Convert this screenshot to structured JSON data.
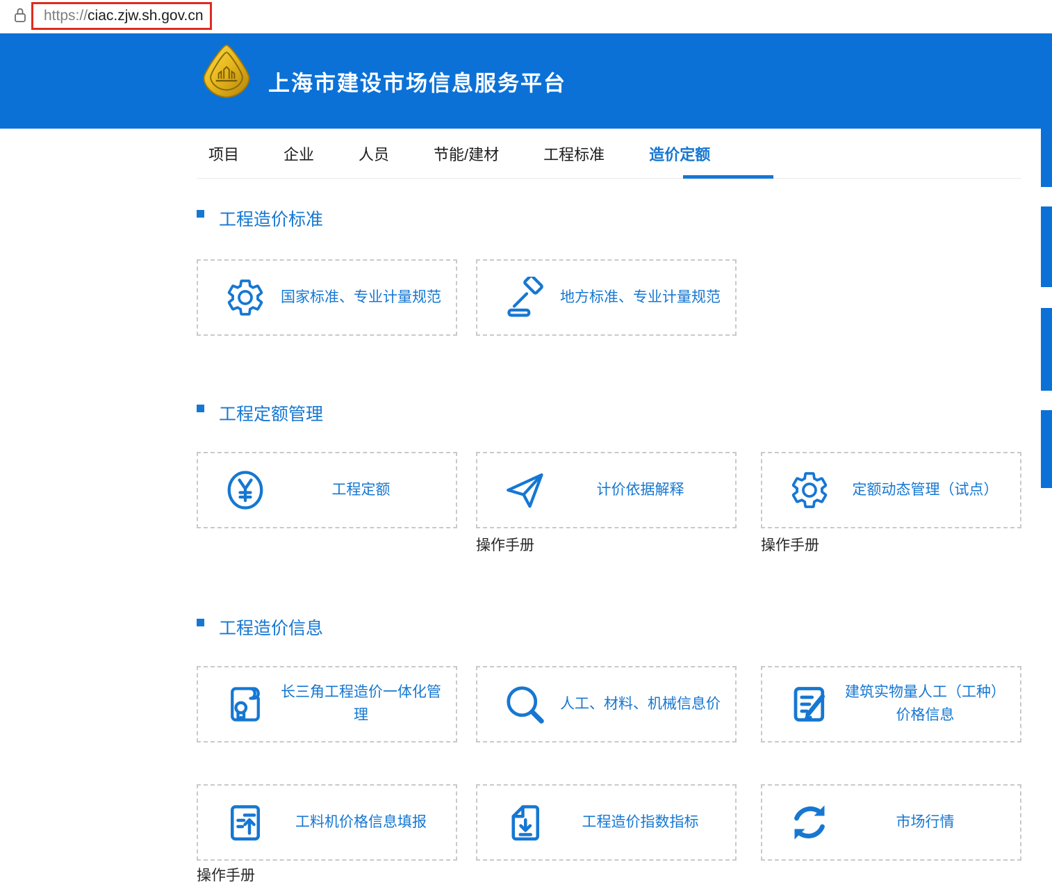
{
  "browser": {
    "url_scheme": "https://",
    "url_host": "ciac.zjw.sh.gov.cn"
  },
  "header": {
    "title": "上海市建设市场信息服务平台"
  },
  "nav": {
    "tabs": [
      {
        "label": "项目"
      },
      {
        "label": "企业"
      },
      {
        "label": "人员"
      },
      {
        "label": "节能/建材"
      },
      {
        "label": "工程标准"
      },
      {
        "label": "造价定额",
        "active": true
      }
    ]
  },
  "sections": [
    {
      "title": "工程造价标准",
      "cards": [
        {
          "icon": "gear-icon",
          "label": "国家标准、专业计量规范"
        },
        {
          "icon": "gavel-icon",
          "label": "地方标准、专业计量规范"
        }
      ]
    },
    {
      "title": "工程定额管理",
      "cards": [
        {
          "icon": "yuan-icon",
          "label": "工程定额"
        },
        {
          "icon": "paper-plane-icon",
          "label": "计价依据解释",
          "manual": "操作手册"
        },
        {
          "icon": "gear-icon",
          "label": "定额动态管理（试点）",
          "manual": "操作手册"
        }
      ]
    },
    {
      "title": "工程造价信息",
      "cards": [
        {
          "icon": "certificate-icon",
          "label": "长三角工程造价一体化管理"
        },
        {
          "icon": "search-icon",
          "label": "人工、材料、机械信息价"
        },
        {
          "icon": "edit-document-icon",
          "label": "建筑实物量人工（工种）价格信息"
        },
        {
          "icon": "upload-document-icon",
          "label": "工料机价格信息填报",
          "manual": "操作手册"
        },
        {
          "icon": "download-document-icon",
          "label": "工程造价指数指标"
        },
        {
          "icon": "refresh-icon",
          "label": "市场行情"
        }
      ]
    }
  ],
  "colors": {
    "header_blue": "#0b71d7",
    "accent_blue": "#1677d2",
    "url_highlight_red": "#e02b1d"
  }
}
